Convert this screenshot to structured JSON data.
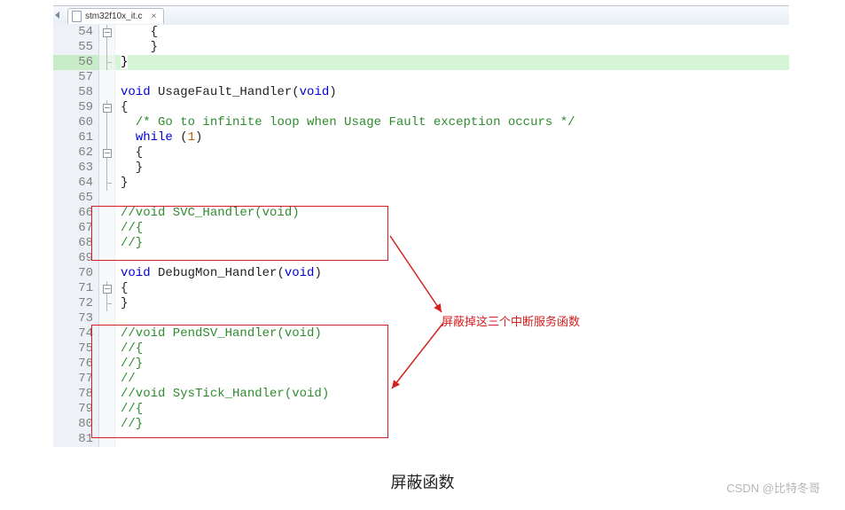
{
  "tab": {
    "filename": "stm32f10x_it.c"
  },
  "lines": [
    {
      "n": 54,
      "fold": "open",
      "cls": "",
      "html": "    {"
    },
    {
      "n": 55,
      "fold": "line",
      "cls": "",
      "html": "    }"
    },
    {
      "n": 56,
      "fold": "end",
      "cls": "current",
      "html": "<span class='brace-hl'>}</span>"
    },
    {
      "n": 57,
      "fold": "",
      "cls": "",
      "html": ""
    },
    {
      "n": 58,
      "fold": "",
      "cls": "",
      "html": "<span class='kw'>void</span> <span class='fn'>UsageFault_Handler</span>(<span class='type'>void</span>)"
    },
    {
      "n": 59,
      "fold": "open",
      "cls": "",
      "html": "{"
    },
    {
      "n": 60,
      "fold": "line",
      "cls": "",
      "html": "  <span class='cmt'>/* Go to infinite loop when Usage Fault exception occurs */</span>"
    },
    {
      "n": 61,
      "fold": "line",
      "cls": "",
      "html": "  <span class='kw'>while</span> (<span class='num'>1</span>)"
    },
    {
      "n": 62,
      "fold": "open",
      "cls": "",
      "html": "  {"
    },
    {
      "n": 63,
      "fold": "line",
      "cls": "",
      "html": "  }"
    },
    {
      "n": 64,
      "fold": "end",
      "cls": "",
      "html": "}"
    },
    {
      "n": 65,
      "fold": "",
      "cls": "",
      "html": ""
    },
    {
      "n": 66,
      "fold": "",
      "cls": "",
      "html": "<span class='cmt'>//void SVC_Handler(void)</span>"
    },
    {
      "n": 67,
      "fold": "",
      "cls": "",
      "html": "<span class='cmt'>//{</span>"
    },
    {
      "n": 68,
      "fold": "",
      "cls": "",
      "html": "<span class='cmt'>//}</span>"
    },
    {
      "n": 69,
      "fold": "",
      "cls": "",
      "html": ""
    },
    {
      "n": 70,
      "fold": "",
      "cls": "",
      "html": "<span class='kw'>void</span> <span class='fn'>DebugMon_Handler</span>(<span class='type'>void</span>)"
    },
    {
      "n": 71,
      "fold": "open",
      "cls": "",
      "html": "{"
    },
    {
      "n": 72,
      "fold": "end",
      "cls": "",
      "html": "}"
    },
    {
      "n": 73,
      "fold": "",
      "cls": "",
      "html": ""
    },
    {
      "n": 74,
      "fold": "",
      "cls": "",
      "html": "<span class='cmt'>//void PendSV_Handler(void)</span>"
    },
    {
      "n": 75,
      "fold": "",
      "cls": "",
      "html": "<span class='cmt'>//{</span>"
    },
    {
      "n": 76,
      "fold": "",
      "cls": "",
      "html": "<span class='cmt'>//}</span>"
    },
    {
      "n": 77,
      "fold": "",
      "cls": "",
      "html": "<span class='cmt'>//</span>"
    },
    {
      "n": 78,
      "fold": "",
      "cls": "",
      "html": "<span class='cmt'>//void SysTick_Handler(void)</span>"
    },
    {
      "n": 79,
      "fold": "",
      "cls": "",
      "html": "<span class='cmt'>//{</span>"
    },
    {
      "n": 80,
      "fold": "",
      "cls": "",
      "html": "<span class='cmt'>//}</span>"
    },
    {
      "n": 81,
      "fold": "",
      "cls": "",
      "html": ""
    }
  ],
  "annotation": {
    "text": "屏蔽掉这三个中断服务函数"
  },
  "caption": "屏蔽函数",
  "watermark": "CSDN @比特冬哥"
}
